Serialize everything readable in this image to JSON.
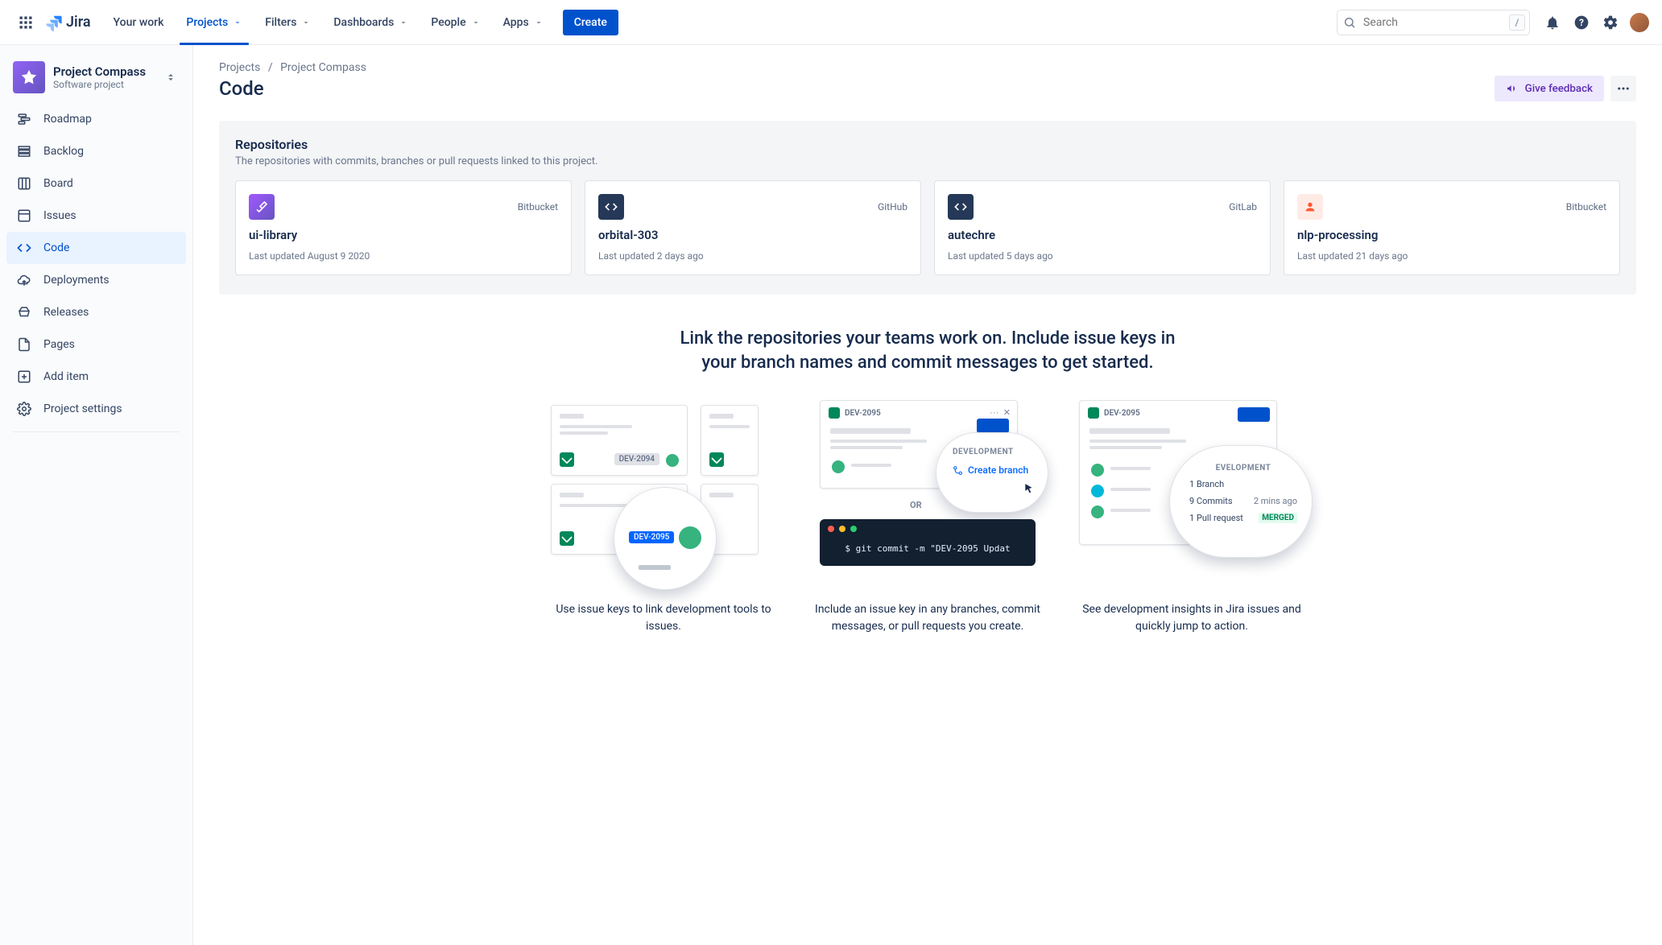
{
  "nav": {
    "logo_text": "Jira",
    "items": [
      {
        "label": "Your work",
        "dropdown": false,
        "active": false
      },
      {
        "label": "Projects",
        "dropdown": true,
        "active": true
      },
      {
        "label": "Filters",
        "dropdown": true,
        "active": false
      },
      {
        "label": "Dashboards",
        "dropdown": true,
        "active": false
      },
      {
        "label": "People",
        "dropdown": true,
        "active": false
      },
      {
        "label": "Apps",
        "dropdown": true,
        "active": false
      }
    ],
    "create_label": "Create",
    "search_placeholder": "Search",
    "search_shortcut": "/"
  },
  "project": {
    "name": "Project Compass",
    "type": "Software project"
  },
  "sidebar": {
    "items": [
      {
        "label": "Roadmap"
      },
      {
        "label": "Backlog"
      },
      {
        "label": "Board"
      },
      {
        "label": "Issues"
      },
      {
        "label": "Code"
      },
      {
        "label": "Deployments"
      },
      {
        "label": "Releases"
      },
      {
        "label": "Pages"
      },
      {
        "label": "Add item"
      },
      {
        "label": "Project settings"
      }
    ],
    "selected_index": 4
  },
  "breadcrumbs": [
    {
      "label": "Projects"
    },
    {
      "label": "Project Compass"
    }
  ],
  "page_title": "Code",
  "feedback_label": "Give feedback",
  "repositories": {
    "title": "Repositories",
    "subtitle": "The repositories with commits, branches or pull requests linked to this project.",
    "cards": [
      {
        "name": "ui-library",
        "source": "Bitbucket",
        "updated": "Last updated August 9 2020",
        "style": "bitbucket"
      },
      {
        "name": "orbital-303",
        "source": "GitHub",
        "updated": "Last updated 2 days ago",
        "style": "github"
      },
      {
        "name": "autechre",
        "source": "GitLab",
        "updated": "Last updated 5 days ago",
        "style": "gitlab"
      },
      {
        "name": "nlp-processing",
        "source": "Bitbucket",
        "updated": "Last updated 21 days ago",
        "style": "nlp"
      }
    ]
  },
  "hero": {
    "headline": "Link the repositories your teams work on. Include issue keys in your branch names and commit messages to get started.",
    "columns": [
      {
        "caption": "Use issue keys to link development tools to issues.",
        "issue_key_a": "DEV-2094",
        "issue_key_b": "DEV-2095"
      },
      {
        "caption": "Include an issue key in any branches, commit messages, or pull requests you create.",
        "issue_key": "DEV-2095",
        "dev_label": "DEVELOPMENT",
        "create_branch": "Create branch",
        "or_label": "OR",
        "terminal_cmd": "$ git commit -m \"DEV-2095 Updat"
      },
      {
        "caption": "See development insights in Jira issues and quickly jump to action.",
        "issue_key": "DEV-2095",
        "dev_label": "EVELOPMENT",
        "rows": [
          {
            "left": "1 Branch",
            "right": ""
          },
          {
            "left": "9 Commits",
            "right": "2 mins ago"
          },
          {
            "left": "1 Pull request",
            "right": "MERGED"
          }
        ]
      }
    ]
  }
}
